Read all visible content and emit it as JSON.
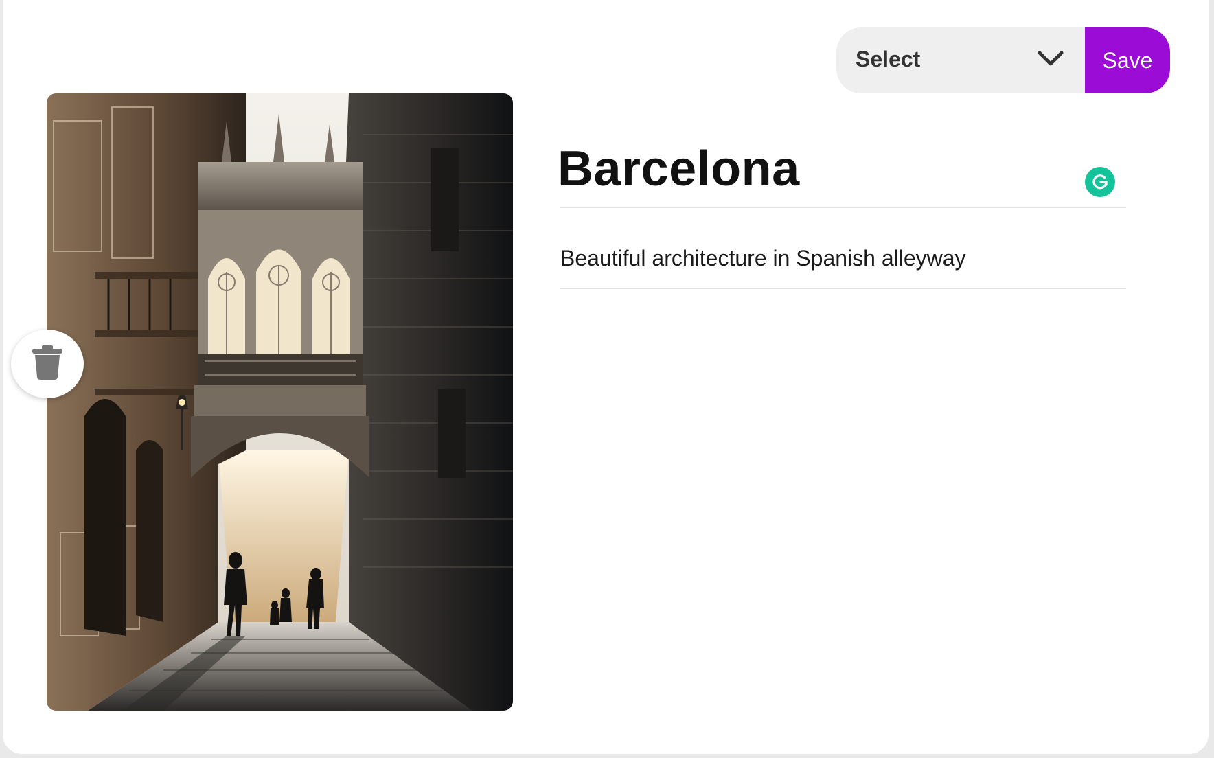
{
  "pin": {
    "title": "Barcelona",
    "description": "Beautiful architecture in Spanish alleyway",
    "image_subject": "Gothic stone bridge over a narrow sunlit alleyway"
  },
  "toolbar": {
    "board_select_label": "Select",
    "save_label": "Save"
  },
  "icons": {
    "dropdown": "chevron-down-icon",
    "delete": "trash-icon",
    "grammar": "grammarly-icon"
  },
  "colors": {
    "accent": "#9b0dd6",
    "select_bg": "#efefef",
    "grammarly": "#15c39a"
  }
}
